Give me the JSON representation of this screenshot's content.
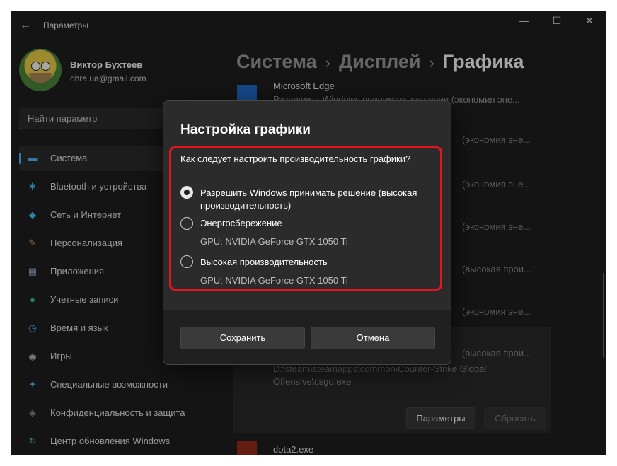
{
  "window": {
    "title": "Параметры",
    "back_icon": "back-arrow-icon",
    "minimize_glyph": "—",
    "maximize_glyph": "☐",
    "close_glyph": "✕"
  },
  "user": {
    "name": "Виктор Бухтеев",
    "email": "ohra.ua@gmail.com"
  },
  "search": {
    "placeholder": "Найти параметр"
  },
  "sidebar": {
    "items": [
      {
        "label": "Система",
        "icon": "monitor-icon",
        "glyph": "▬",
        "color": "#4cc2ff"
      },
      {
        "label": "Bluetooth и устройства",
        "icon": "bluetooth-icon",
        "glyph": "✱",
        "color": "#4cc2ff"
      },
      {
        "label": "Сеть и Интернет",
        "icon": "wifi-icon",
        "glyph": "◆",
        "color": "#4cc2ff"
      },
      {
        "label": "Персонализация",
        "icon": "brush-icon",
        "glyph": "✎",
        "color": "#e8a95c"
      },
      {
        "label": "Приложения",
        "icon": "apps-icon",
        "glyph": "▦",
        "color": "#9fb4d6"
      },
      {
        "label": "Учетные записи",
        "icon": "person-icon",
        "glyph": "●",
        "color": "#37c0a3"
      },
      {
        "label": "Время и язык",
        "icon": "clock-globe-icon",
        "glyph": "◷",
        "color": "#4cc2ff"
      },
      {
        "label": "Игры",
        "icon": "gamepad-icon",
        "glyph": "◉",
        "color": "#b8b8b8"
      },
      {
        "label": "Специальные возможности",
        "icon": "accessibility-icon",
        "glyph": "✦",
        "color": "#4cc2ff"
      },
      {
        "label": "Конфиденциальность и защита",
        "icon": "shield-icon",
        "glyph": "◈",
        "color": "#9a9a9a"
      },
      {
        "label": "Центр обновления Windows",
        "icon": "update-icon",
        "glyph": "↻",
        "color": "#4cc2ff"
      }
    ]
  },
  "breadcrumb": {
    "part1": "Система",
    "part2": "Дисплей",
    "part3": "Графика",
    "separator": "›"
  },
  "app_list": {
    "first_app_title": "Microsoft Edge",
    "first_app_sub": "Разрешить Windows принимать решение (экономия эне...",
    "faded_rows": [
      "(экономия эне...",
      "(экономия эне...",
      "(экономия эне...",
      "(высокая прои...",
      "(экономия эне...",
      "(экономия эне..."
    ],
    "expanded": {
      "sub": "(высокая прои...",
      "path_line1": "D:\\steam\\steamapps\\common\\Counter-Strike Global",
      "path_line2": "Offensive\\csgo.exe",
      "params_button": "Параметры",
      "reset_button": "Сбросить"
    },
    "last_app_title": "dota2.exe"
  },
  "dialog": {
    "title": "Настройка графики",
    "question": "Как следует настроить производительность графики?",
    "options": [
      {
        "label": "Разрешить Windows принимать решение (высокая производительность)",
        "sub": "",
        "checked": true
      },
      {
        "label": "Энергосбережение",
        "sub": "GPU: NVIDIA GeForce GTX 1050 Ti",
        "checked": false
      },
      {
        "label": "Высокая производительность",
        "sub": "GPU: NVIDIA GeForce GTX 1050 Ti",
        "checked": false
      }
    ],
    "save_button": "Сохранить",
    "cancel_button": "Отмена"
  },
  "colors": {
    "accent": "#4cc2ff",
    "highlight": "#e4151f",
    "background": "#202020"
  }
}
